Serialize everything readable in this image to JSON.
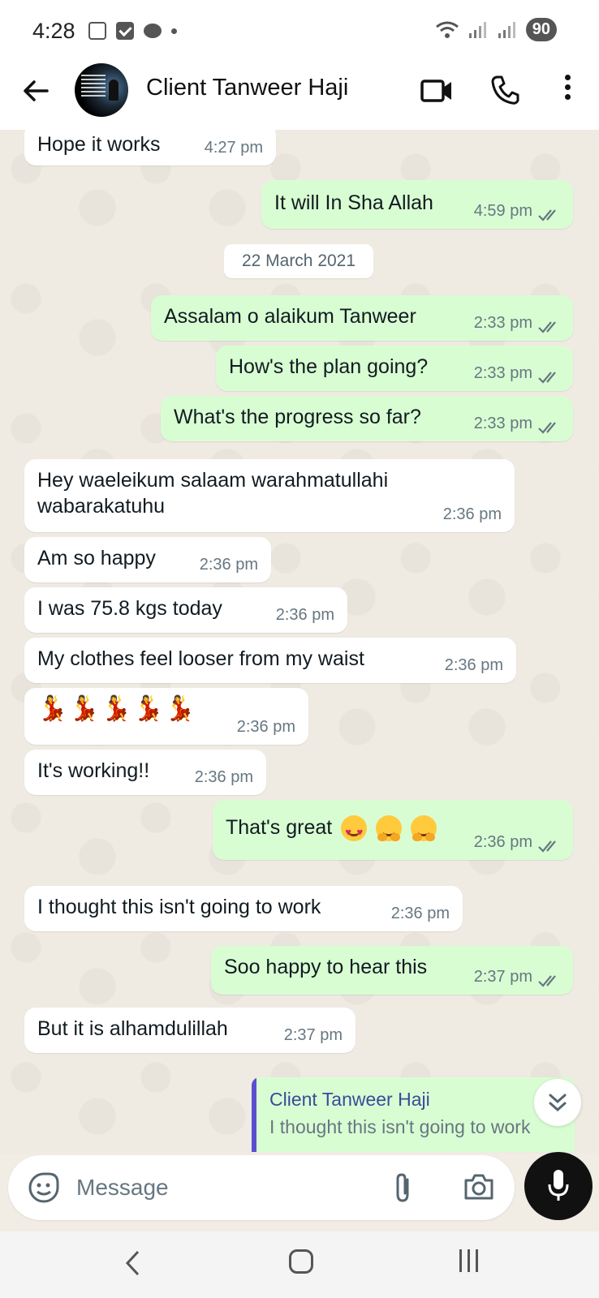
{
  "status_bar": {
    "time": "4:28",
    "battery": "90"
  },
  "header": {
    "contact_name": "Client Tanweer Haji"
  },
  "chat": {
    "date_separator": "22 March 2021",
    "messages": [
      {
        "dir": "in",
        "text": "Hope it works",
        "time": "4:27 pm"
      },
      {
        "dir": "out",
        "text": "It will In Sha Allah",
        "time": "4:59 pm"
      },
      {
        "dir": "out",
        "text": "Assalam o alaikum Tanweer",
        "time": "2:33 pm"
      },
      {
        "dir": "out",
        "text": "How's the plan going?",
        "time": "2:33 pm"
      },
      {
        "dir": "out",
        "text": "What's the progress so far?",
        "time": "2:33 pm"
      },
      {
        "dir": "in",
        "text": "Hey waeleikum salaam warahmatullahi wabarakatuhu",
        "time": "2:36 pm"
      },
      {
        "dir": "in",
        "text": "Am so happy",
        "time": "2:36 pm"
      },
      {
        "dir": "in",
        "text": "I was 75.8 kgs today",
        "time": "2:36 pm"
      },
      {
        "dir": "in",
        "text": "My clothes feel looser from my waist",
        "time": "2:36 pm"
      },
      {
        "dir": "in",
        "text": "💃💃💃💃💃",
        "time": "2:36 pm"
      },
      {
        "dir": "in",
        "text": "It's working!!",
        "time": "2:36 pm"
      },
      {
        "dir": "out",
        "text": "That's great",
        "time": "2:36 pm"
      },
      {
        "dir": "in",
        "text": "I thought this isn't going to work",
        "time": "2:36 pm"
      },
      {
        "dir": "out",
        "text": "Soo happy to hear this",
        "time": "2:37 pm"
      },
      {
        "dir": "in",
        "text": "But it is alhamdulillah",
        "time": "2:37 pm"
      }
    ]
  },
  "reply_preview": {
    "name": "Client Tanweer Haji",
    "text": "I thought this isn't going to work"
  },
  "composer": {
    "placeholder": "Message"
  },
  "colors": {
    "outgoing_bubble": "#d9fdd3",
    "incoming_bubble": "#ffffff",
    "tick_color": "#53bdeb"
  }
}
